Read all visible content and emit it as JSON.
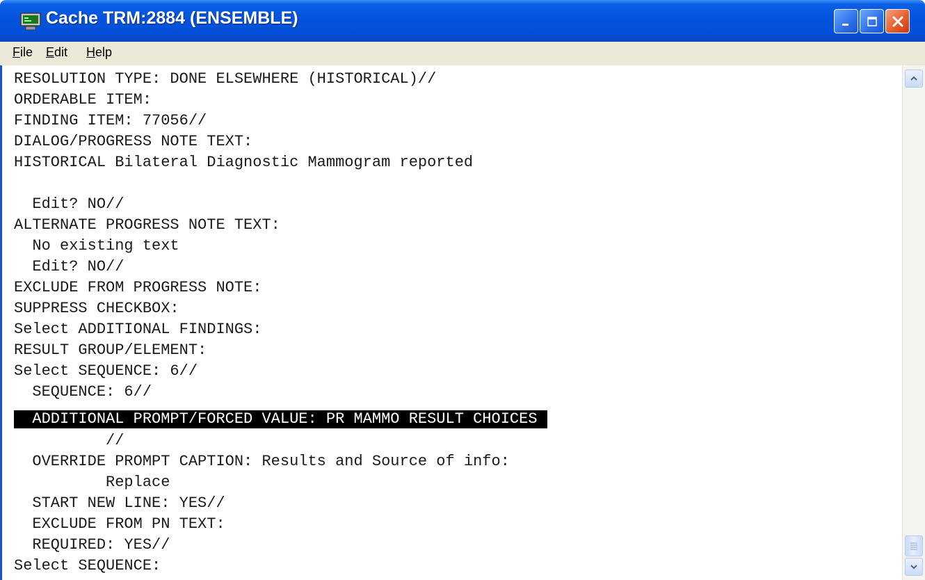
{
  "window": {
    "title": "Cache TRM:2884 (ENSEMBLE)",
    "icon": "terminal-app-icon",
    "controls": [
      "minimize-icon",
      "maximize-icon",
      "close-icon"
    ]
  },
  "menu": {
    "file": "ile",
    "file_accel": "F",
    "edit": "dit",
    "edit_accel": "E",
    "help": "elp",
    "help_accel": "H"
  },
  "terminal": {
    "lines": [
      "RESOLUTION TYPE: DONE ELSEWHERE (HISTORICAL)//",
      "ORDERABLE ITEM:",
      "FINDING ITEM: 77056//",
      "DIALOG/PROGRESS NOTE TEXT:",
      "HISTORICAL Bilateral Diagnostic Mammogram reported",
      "",
      "  Edit? NO//",
      "ALTERNATE PROGRESS NOTE TEXT:",
      "  No existing text",
      "  Edit? NO//",
      "EXCLUDE FROM PROGRESS NOTE:",
      "SUPPRESS CHECKBOX:",
      "Select ADDITIONAL FINDINGS:",
      "RESULT GROUP/ELEMENT:",
      "Select SEQUENCE: 6//",
      "  SEQUENCE: 6//",
      "  ADDITIONAL PROMPT/FORCED VALUE: PR MAMMO RESULT CHOICES",
      "          //",
      "  OVERRIDE PROMPT CAPTION: Results and Source of info:",
      "          Replace",
      "  START NEW LINE: YES//",
      "  EXCLUDE FROM PN TEXT:",
      "  REQUIRED: YES//",
      "Select SEQUENCE:"
    ],
    "highlighted_line_index": 16
  },
  "colors": {
    "titlebar": "#0453dc",
    "menubar": "#ece9d8",
    "highlight_bg": "#000000",
    "highlight_fg": "#ffffff"
  }
}
